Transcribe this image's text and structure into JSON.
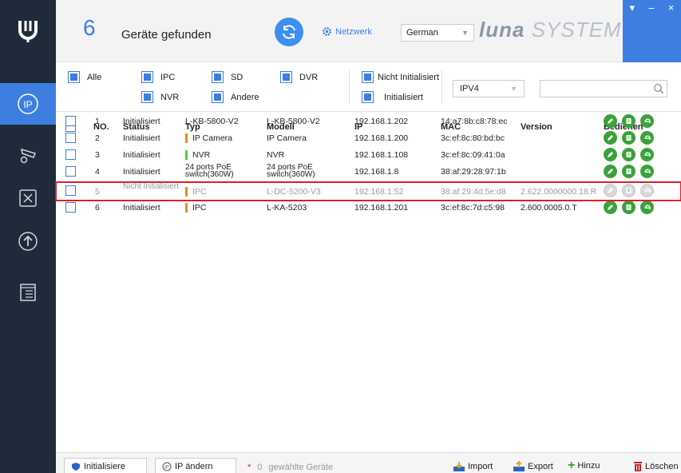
{
  "sidebar": {
    "logo_text": "U",
    "items": [
      {
        "name": "ip-config",
        "active": true
      },
      {
        "name": "camera-settings",
        "active": false
      },
      {
        "name": "tools",
        "active": false
      },
      {
        "name": "upgrade",
        "active": false
      },
      {
        "name": "documents",
        "active": false
      }
    ]
  },
  "header": {
    "device_count": "6",
    "found_label": "Geräte gefunden",
    "netzwerk_label": "Netzwerk",
    "language": "German",
    "brand_luna": "luna",
    "brand_system": "SYSTEM",
    "win_menu": "▾",
    "win_min": "–",
    "win_close": "×"
  },
  "filters": {
    "all": "Alle",
    "ipc": "IPC",
    "sd": "SD",
    "dvr": "DVR",
    "nvr": "NVR",
    "andere": "Andere",
    "nicht_init": "Nicht Initialisiert",
    "init": "Initialisiert",
    "ip_version": "IPV4",
    "search_value": ""
  },
  "table": {
    "columns": {
      "no": "NO.",
      "status": "Status",
      "type": "Typ",
      "model": "Modell",
      "ip": "IP",
      "mac": "MAC",
      "version": "Version",
      "actions": "Bedienen"
    },
    "rows": [
      {
        "no": "1",
        "status": "Initialisiert",
        "type": "L-KB-5800-V2",
        "model": "L-KB-5800-V2",
        "ip": "192.168.1.202",
        "mac": "14:a7:8b:c8:78:ec",
        "version": "",
        "type_color": ""
      },
      {
        "no": "2",
        "status": "Initialisiert",
        "type": "IP Camera",
        "model": "IP Camera",
        "ip": "192.168.1.200",
        "mac": "3c:ef:8c:80:bd:bc",
        "version": "",
        "type_color": "#f08a24"
      },
      {
        "no": "3",
        "status": "Initialisiert",
        "type": "NVR",
        "model": "NVR",
        "ip": "192.168.1.108",
        "mac": "3c:ef:8c:09:41:0a",
        "version": "",
        "type_color": "#5ec832"
      },
      {
        "no": "4",
        "status": "Initialisiert",
        "type": "24 ports PoE switch(360W)",
        "model": "24 ports PoE switch(360W)",
        "ip": "192.168.1.8",
        "mac": "38:af:29:28:97:1b",
        "version": "",
        "type_color": ""
      },
      {
        "no": "5",
        "status": "Nicht Initialisiert",
        "type": "IPC",
        "model": "L-DC-5200-V3",
        "ip": "192.168.1.52",
        "mac": "38:af:29:4d:5e:d8",
        "version": "2.622.0000000.18.R",
        "type_color": "#f08a24"
      },
      {
        "no": "6",
        "status": "Initialisiert",
        "type": "IPC",
        "model": "L-KA-5203",
        "ip": "192.168.1.201",
        "mac": "3c:ef:8c:7d:c5:98",
        "version": "2.600.0005.0.T",
        "type_color": "#f08a24"
      }
    ]
  },
  "bottom": {
    "initialize": "Initialisiere",
    "change_ip": "IP ändern",
    "star": "*",
    "selected_count": "0",
    "selected_label": "gewählte Geräte",
    "import": "Import",
    "export": "Export",
    "add": "Hinzu",
    "delete": "Löschen"
  },
  "colors": {
    "accent": "#3d7ee0",
    "sidebar": "#1f2a3a",
    "highlight": "#d8202a",
    "action_green": "#3aa23a"
  }
}
